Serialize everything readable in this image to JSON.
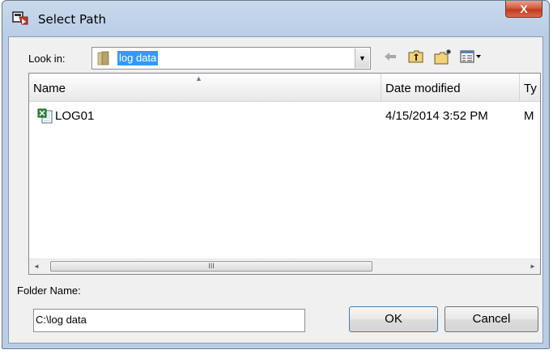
{
  "window": {
    "title": "Select Path",
    "close_glyph": "X"
  },
  "look_in": {
    "label": "Look in:",
    "value": "log data",
    "dropdown_glyph": "▼"
  },
  "toolbar": {
    "back_icon": "back-arrow-icon",
    "up_icon": "up-one-level-icon",
    "new_folder_icon": "new-folder-icon",
    "view_menu_icon": "view-menu-icon"
  },
  "file_list": {
    "columns": [
      {
        "label": "Name"
      },
      {
        "label": "Date modified"
      },
      {
        "label": "Ty"
      }
    ],
    "rows": [
      {
        "name": "LOG01",
        "date_modified": "4/15/2014 3:52 PM",
        "type": "M",
        "icon": "excel-file-icon"
      }
    ],
    "scrollbar": {
      "left_glyph": "◄",
      "right_glyph": "►",
      "thumb_grip": "III"
    }
  },
  "folder_name": {
    "label": "Folder Name:",
    "value": "C:\\log data"
  },
  "buttons": {
    "ok_label": "OK",
    "cancel_label": "Cancel"
  },
  "colors": {
    "selection": "#3399ff",
    "close_button": "#c23a1c",
    "title_bar": "#c9d9ec"
  }
}
